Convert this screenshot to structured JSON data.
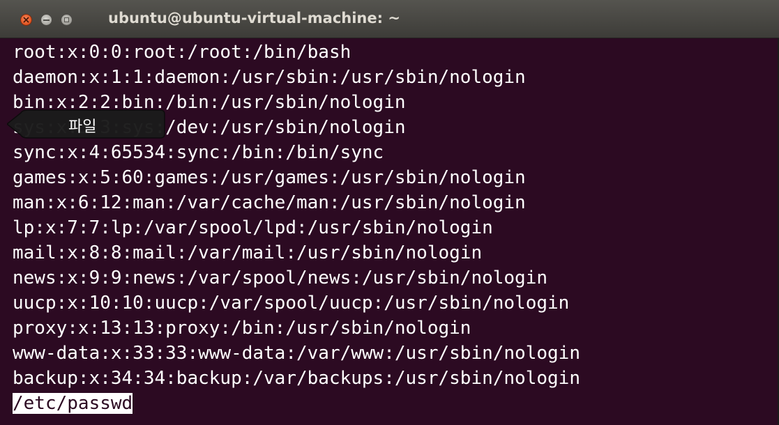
{
  "window": {
    "title": "ubuntu@ubuntu-virtual-machine: ~",
    "buttons": {
      "close": "close-icon",
      "minimize": "minimize-icon",
      "maximize": "maximize-icon"
    },
    "colors": {
      "terminal_background": "#2c0a22",
      "text": "#ffffff",
      "close_button": "#e0521e"
    }
  },
  "terminal": {
    "lines": [
      "root:x:0:0:root:/root:/bin/bash",
      "daemon:x:1:1:daemon:/usr/sbin:/usr/sbin/nologin",
      "bin:x:2:2:bin:/bin:/usr/sbin/nologin",
      "sys:x:3:3:sys:/dev:/usr/sbin/nologin",
      "sync:x:4:65534:sync:/bin:/bin/sync",
      "games:x:5:60:games:/usr/games:/usr/sbin/nologin",
      "man:x:6:12:man:/var/cache/man:/usr/sbin/nologin",
      "lp:x:7:7:lp:/var/spool/lpd:/usr/sbin/nologin",
      "mail:x:8:8:mail:/var/mail:/usr/sbin/nologin",
      "news:x:9:9:news:/var/spool/news:/usr/sbin/nologin",
      "uucp:x:10:10:uucp:/var/spool/uucp:/usr/sbin/nologin",
      "proxy:x:13:13:proxy:/bin:/usr/sbin/nologin",
      "www-data:x:33:33:www-data:/var/www:/usr/sbin/nologin",
      "backup:x:34:34:backup:/var/backups:/usr/sbin/nologin"
    ],
    "status_line": "/etc/passwd"
  },
  "tooltip": {
    "label": "파일"
  }
}
